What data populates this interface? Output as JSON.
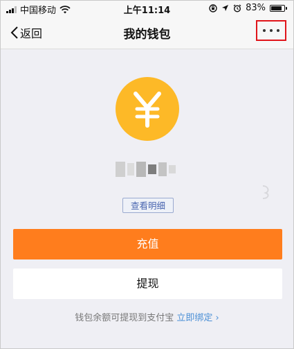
{
  "status_bar": {
    "carrier": "中国移动",
    "time": "上午11:14",
    "battery_percent": "83%",
    "battery_level": 0.83,
    "icons": [
      "signal-icon",
      "wifi-icon",
      "rotation-lock-icon",
      "location-icon",
      "alarm-icon",
      "battery-icon"
    ]
  },
  "nav": {
    "back_label": "返回",
    "title": "我的钱包",
    "more_label": "···"
  },
  "wallet": {
    "icon_symbol": "¥",
    "icon_color": "#fdb927",
    "view_details_label": "查看明细"
  },
  "actions": {
    "recharge_label": "充值",
    "recharge_color": "#ff7d1d",
    "withdraw_label": "提现"
  },
  "footer": {
    "note": "钱包余额可提现到支付宝",
    "link_label": "立即绑定",
    "link_arrow": "›"
  },
  "colors": {
    "highlight_border": "#e0141a",
    "link": "#4a8fd6"
  }
}
